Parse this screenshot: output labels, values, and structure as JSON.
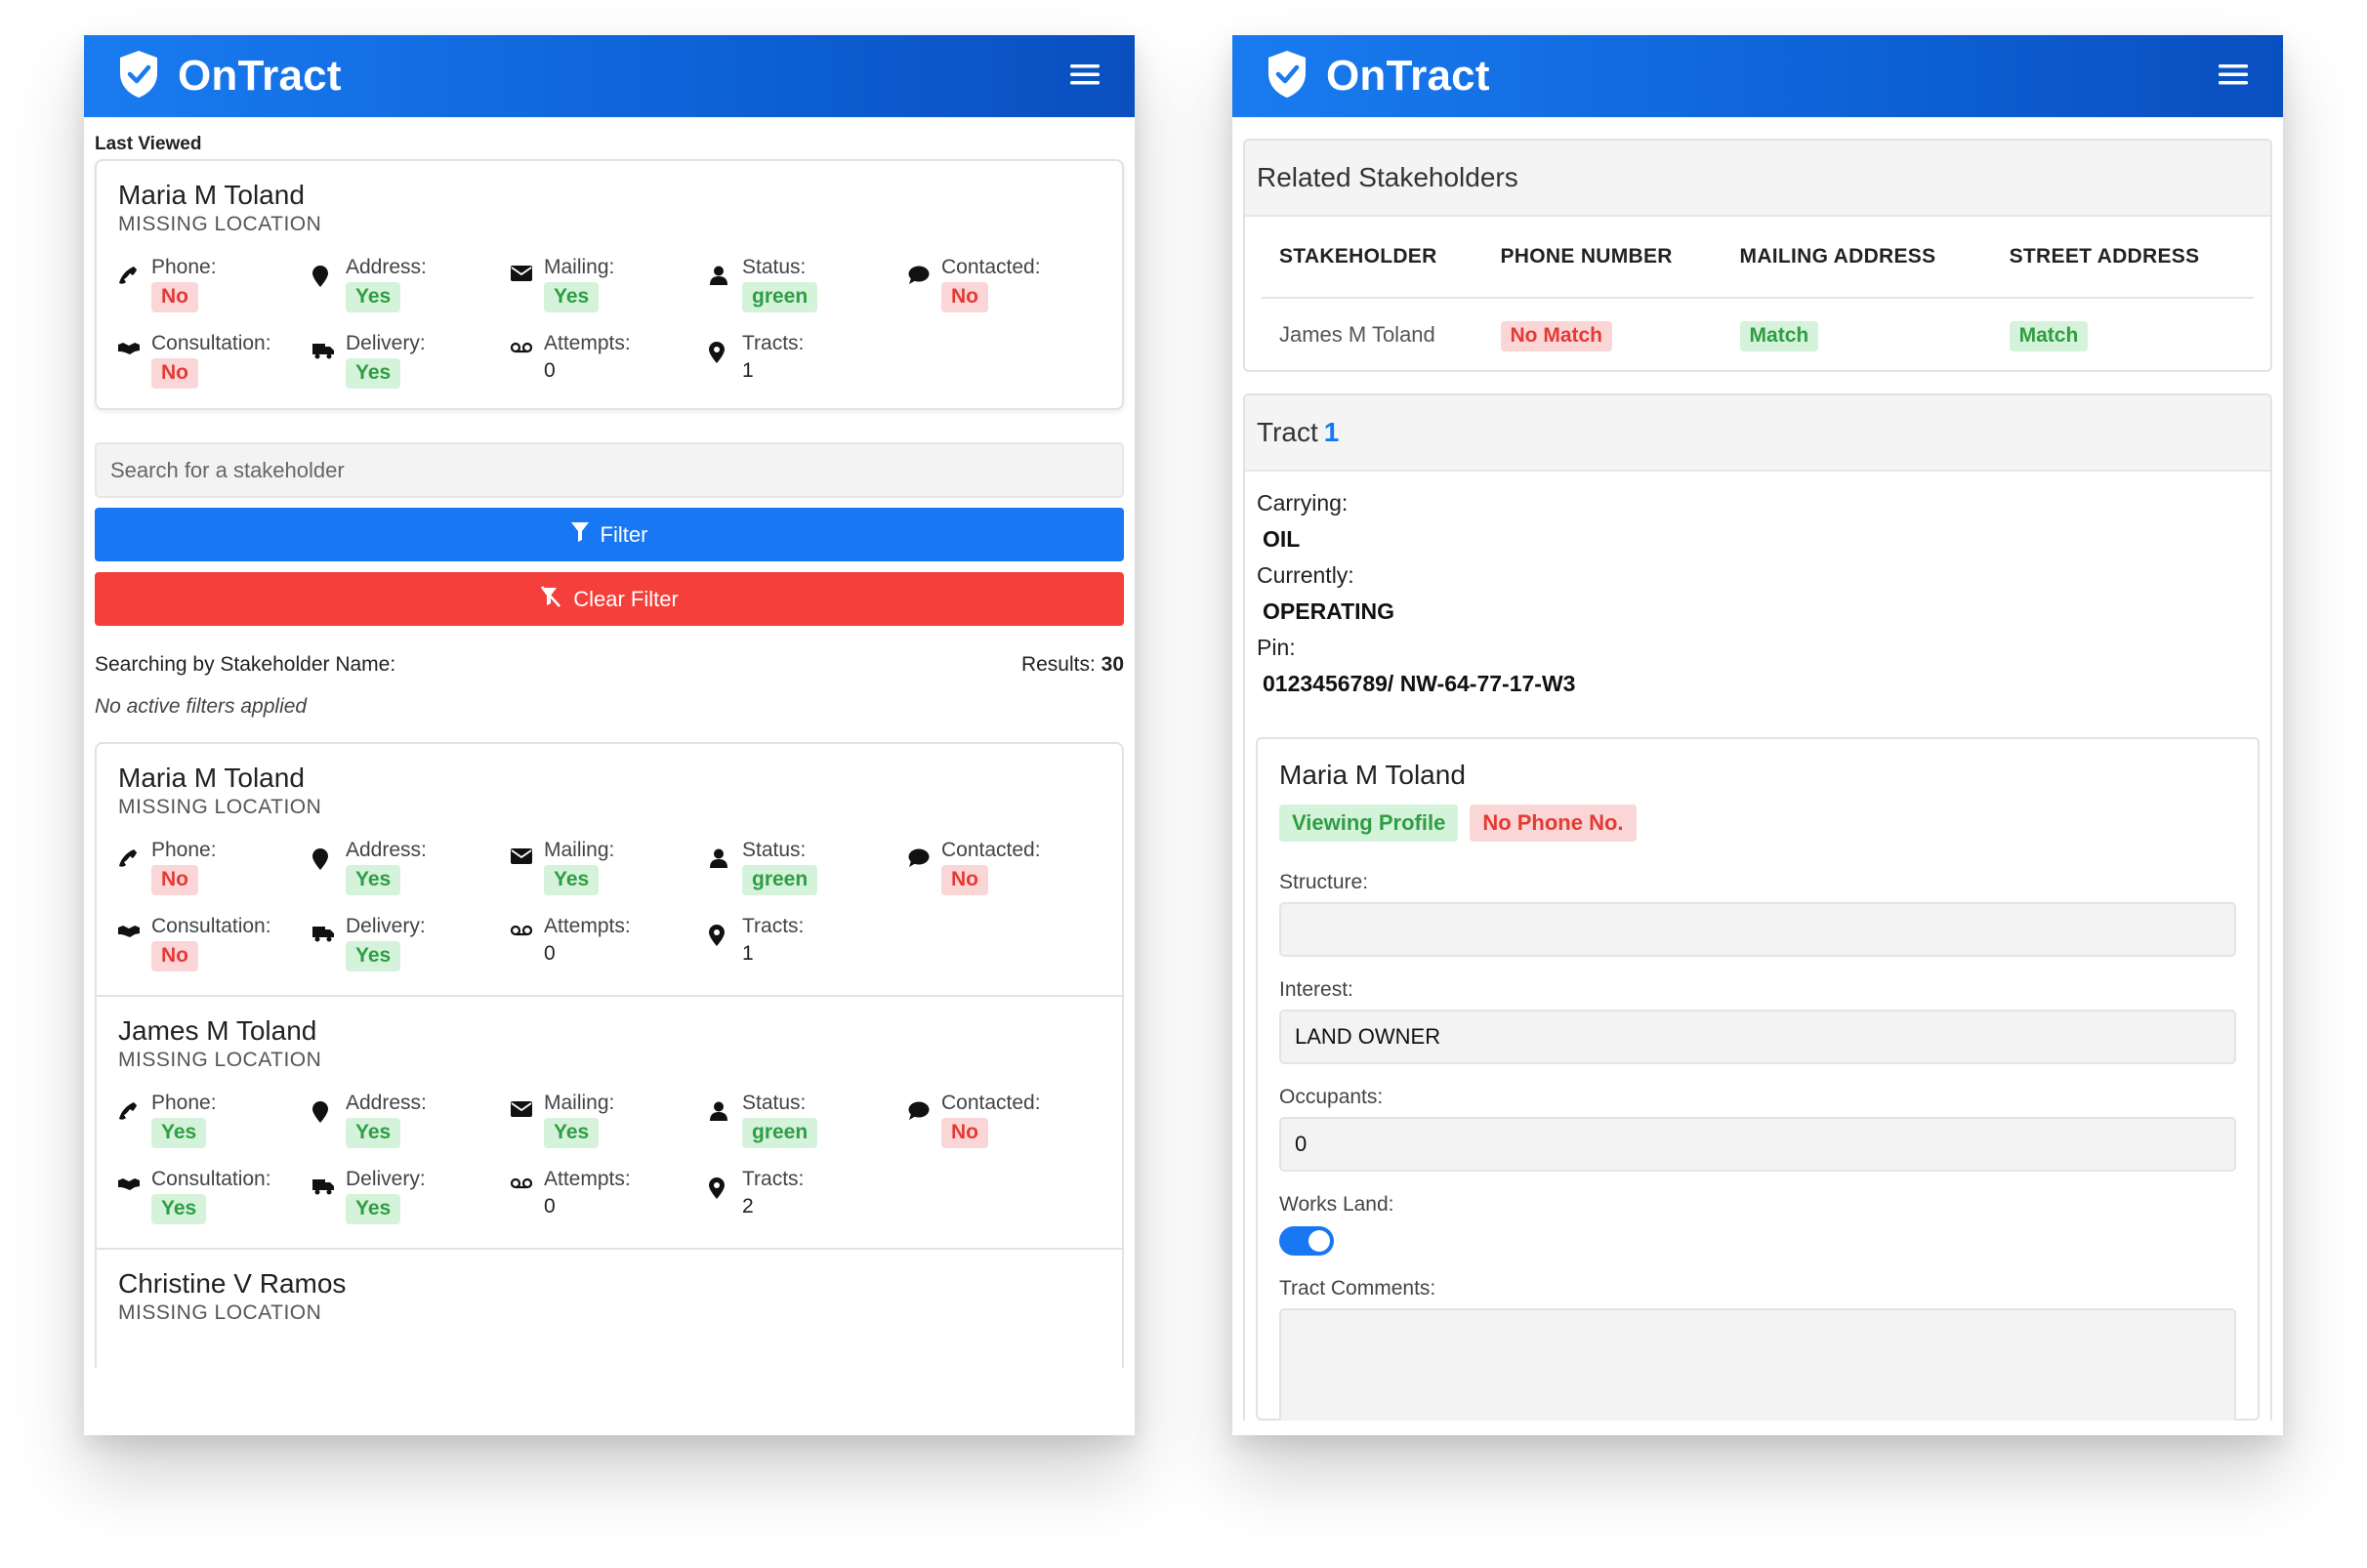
{
  "brand": {
    "name": "OnTract"
  },
  "left": {
    "last_viewed_label": "Last Viewed",
    "last_viewed": {
      "name": "Maria M Toland",
      "location": "MISSING LOCATION",
      "phone": "No",
      "address": "Yes",
      "mailing": "Yes",
      "status": "green",
      "contacted": "No",
      "consultation": "No",
      "delivery": "Yes",
      "attempts": "0",
      "tracts": "1"
    },
    "labels": {
      "phone": "Phone:",
      "address": "Address:",
      "mailing": "Mailing:",
      "status": "Status:",
      "contacted": "Contacted:",
      "consultation": "Consultation:",
      "delivery": "Delivery:",
      "attempts": "Attempts:",
      "tracts": "Tracts:"
    },
    "search_placeholder": "Search for a stakeholder",
    "filter_label": "Filter",
    "clear_filter_label": "Clear Filter",
    "searching_by": "Searching by Stakeholder Name:",
    "results_label": "Results:",
    "results_count": "30",
    "no_filters": "No active filters applied",
    "stakeholders": [
      {
        "name": "Maria M Toland",
        "location": "MISSING LOCATION",
        "phone": "No",
        "address": "Yes",
        "mailing": "Yes",
        "status": "green",
        "contacted": "No",
        "consultation": "No",
        "delivery": "Yes",
        "attempts": "0",
        "tracts": "1"
      },
      {
        "name": "James M Toland",
        "location": "MISSING LOCATION",
        "phone": "Yes",
        "address": "Yes",
        "mailing": "Yes",
        "status": "green",
        "contacted": "No",
        "consultation": "Yes",
        "delivery": "Yes",
        "attempts": "0",
        "tracts": "2"
      },
      {
        "name": "Christine V Ramos",
        "location": "MISSING LOCATION"
      }
    ]
  },
  "right": {
    "related_title": "Related Stakeholders",
    "table": {
      "headers": [
        "STAKEHOLDER",
        "PHONE NUMBER",
        "MAILING ADDRESS",
        "STREET ADDRESS"
      ],
      "row": {
        "stakeholder": "James M Toland",
        "phone": "No Match",
        "mailing": "Match",
        "street": "Match"
      }
    },
    "tract": {
      "title": "Tract",
      "number": "1",
      "carrying_label": "Carrying:",
      "carrying": "OIL",
      "currently_label": "Currently:",
      "currently": "OPERATING",
      "pin_label": "Pin:",
      "pin": "0123456789/ NW-64-77-17-W3"
    },
    "profile": {
      "name": "Maria M Toland",
      "badge_viewing": "Viewing Profile",
      "badge_phone": "No Phone No.",
      "structure_label": "Structure:",
      "structure": "",
      "interest_label": "Interest:",
      "interest": "LAND OWNER",
      "occupants_label": "Occupants:",
      "occupants": "0",
      "works_land_label": "Works Land:",
      "works_land": true,
      "comments_label": "Tract Comments:",
      "comments": ""
    }
  },
  "colors": {
    "primary": "#1877f2",
    "danger": "#f53f3b",
    "badge_red": "#e53935",
    "badge_green": "#2e9e43"
  },
  "icons": [
    "shield-check-icon",
    "hamburger-menu-icon",
    "phone-icon",
    "map-pin-icon",
    "envelope-icon",
    "user-icon",
    "chat-bubble-icon",
    "handshake-icon",
    "truck-icon",
    "voicemail-icon",
    "location-pin-icon",
    "filter-icon",
    "filter-clear-icon"
  ]
}
